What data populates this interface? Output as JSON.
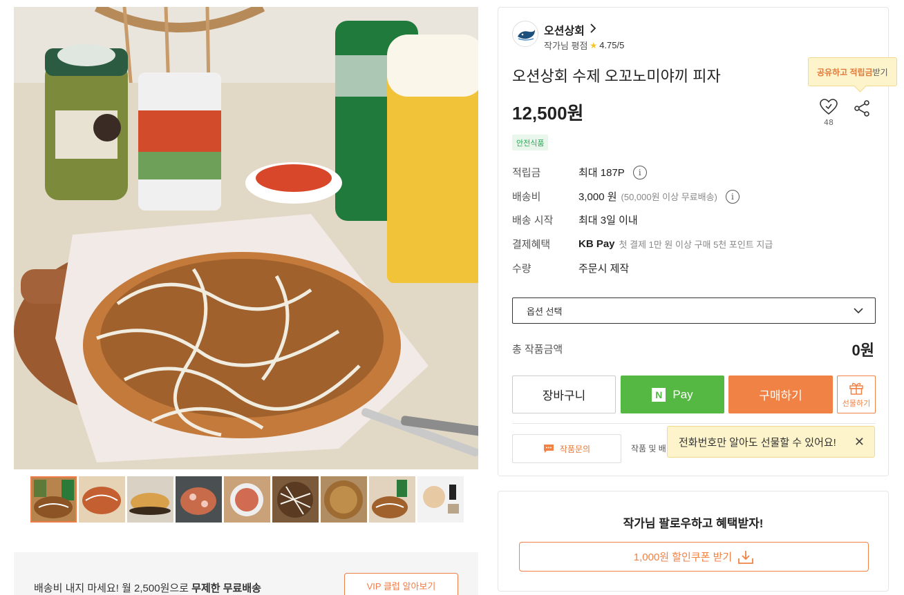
{
  "seller": {
    "name": "오션상회",
    "rating_label": "작가님 평점",
    "rating_value": "4.75/5"
  },
  "product": {
    "title": "오션상회 수제 오꼬노미야끼 피자",
    "price": "12,500원",
    "safe_badge": "안전식품",
    "like_count": "48"
  },
  "share_tooltip": {
    "highlight": "공유하고 적립금",
    "rest": " 받기"
  },
  "info": {
    "points_label": "적립금",
    "points_value": "최대 187P",
    "shipping_label": "배송비",
    "shipping_value": "3,000 원",
    "shipping_sub": "(50,000원 이상 무료배송)",
    "ship_start_label": "배송 시작",
    "ship_start_value": "최대 3일 이내",
    "payment_label": "결제혜택",
    "payment_brand": "KB Pay",
    "payment_value": "첫 결제 1만 원 이상 구매 5천 포인트 지급",
    "quantity_label": "수량",
    "quantity_value": "주문시 제작"
  },
  "option_select": {
    "placeholder": "옵션 선택"
  },
  "total": {
    "label": "총 작품금액",
    "value": "0원"
  },
  "buttons": {
    "cart": "장바구니",
    "npay_logo": "N",
    "npay": "Pay",
    "buy": "구매하기",
    "gift": "선물하기",
    "inquiry": "작품문의",
    "inquiry_side": "작품 및 배"
  },
  "gift_tooltip": {
    "text": "전화번호만 알아도 선물할 수 있어요!",
    "close": "✕"
  },
  "follow": {
    "title": "작가님 팔로우하고 혜택받자!",
    "coupon": "1,000원 할인쿠폰 받기"
  },
  "vip": {
    "text_normal": "배송비 내지 마세요! 월 2,500원으로 ",
    "text_bold": "무제한 무료배송",
    "button": "VIP 클럽 알아보기"
  },
  "thumbnails": [
    "thumb-1",
    "thumb-2",
    "thumb-3",
    "thumb-4",
    "thumb-5",
    "thumb-6",
    "thumb-7",
    "thumb-8",
    "thumb-9"
  ],
  "colors": {
    "accent": "#f08246",
    "npay": "#54b843",
    "safe_green": "#2fa75a",
    "tooltip_bg": "#fdf4cc",
    "star": "#f7c31d"
  },
  "icons": [
    "chevron-right-icon",
    "star-icon",
    "heart-icon",
    "share-icon",
    "info-icon",
    "chevron-down-icon",
    "gift-icon",
    "chat-icon",
    "close-icon",
    "download-icon"
  ]
}
